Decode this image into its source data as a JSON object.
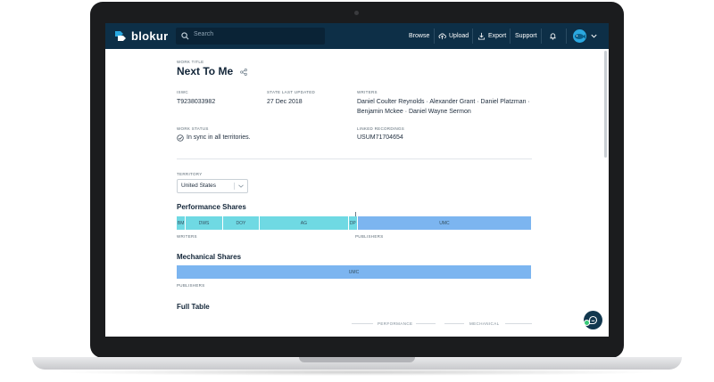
{
  "app": {
    "logo_text": "blokur",
    "search_placeholder": "Search",
    "nav": {
      "browse": "Browse",
      "upload": "Upload",
      "export": "Export",
      "support": "Support"
    }
  },
  "work": {
    "title_label": "WORK TITLE",
    "title": "Next To Me",
    "iswc_label": "ISWC",
    "iswc": "T9238033982",
    "state_label": "STATE LAST UPDATED",
    "state_date": "27 Dec 2018",
    "writers_label": "WRITERS",
    "writers_line1": "Daniel Coulter Reynolds · Alexander Grant · Daniel Platzman ·",
    "writers_line2": "Benjamin Mckee · Daniel Wayne Sermon",
    "status_label": "WORK STATUS",
    "status": "In sync in all territories.",
    "recordings_label": "LINKED RECORDINGS",
    "recording": "USUM71704654"
  },
  "territory": {
    "label": "TERRITORY",
    "selected": "United States"
  },
  "performance": {
    "title": "Performance Shares",
    "writers_caption": "WRITERS",
    "publishers_caption": "PUBLISHERS",
    "segments": [
      {
        "label": "BM",
        "share": 2.6
      },
      {
        "label": "DWS",
        "share": 10.4
      },
      {
        "label": "DOY",
        "share": 10.4
      },
      {
        "label": "AG",
        "share": 25.0
      },
      {
        "label": "DP",
        "share": 2.6
      },
      {
        "label": "UMC",
        "share": 49.0
      }
    ]
  },
  "mechanical": {
    "title": "Mechanical Shares",
    "publishers_caption": "PUBLISHERS",
    "segments": [
      {
        "label": "UMC",
        "share": 100
      }
    ]
  },
  "full_table": {
    "title": "Full Table",
    "group_performance": "PERFORMANCE",
    "group_mechanical": "MECHANICAL"
  },
  "colors": {
    "topbar": "#0d2f47",
    "writer_share": "#6fd9e3",
    "publisher_share": "#7cb5f0"
  }
}
